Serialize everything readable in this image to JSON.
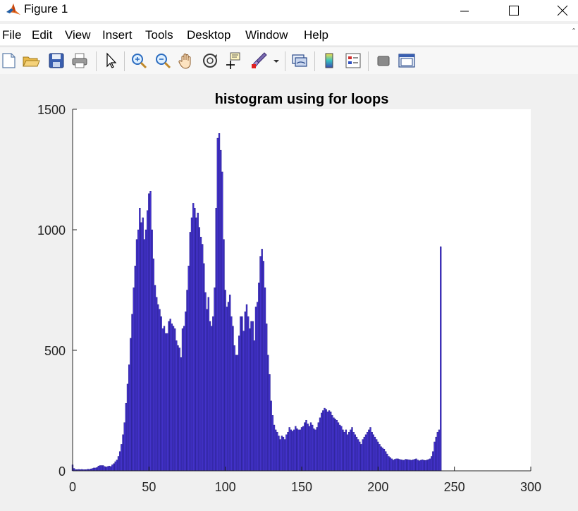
{
  "window": {
    "title": "Figure 1",
    "icon": "matlab-icon"
  },
  "menu": {
    "items": [
      "File",
      "Edit",
      "View",
      "Insert",
      "Tools",
      "Desktop",
      "Window",
      "Help"
    ]
  },
  "toolbar": {
    "icons": [
      "new-figure-icon",
      "open-file-icon",
      "save-icon",
      "print-icon",
      "pointer-icon",
      "zoom-in-icon",
      "zoom-out-icon",
      "pan-icon",
      "rotate-3d-icon",
      "data-cursor-icon",
      "brush-icon",
      "link-plot-icon",
      "colorbar-icon",
      "legend-icon",
      "hide-plot-tools-icon",
      "show-plot-tools-icon"
    ]
  },
  "colors": {
    "bar_fill": "#4433cc",
    "bar_edge": "#1a1280",
    "axes_bg": "#ffffff",
    "figure_bg": "#f0f0f0"
  },
  "chart_data": {
    "type": "bar",
    "title": "histogram using for loops",
    "xlabel": "",
    "ylabel": "",
    "xlim": [
      0,
      300
    ],
    "ylim": [
      0,
      1500
    ],
    "xticks": [
      0,
      50,
      100,
      150,
      200,
      250,
      300
    ],
    "yticks": [
      0,
      500,
      1000,
      1500
    ],
    "grid": false,
    "x": [
      0,
      1,
      2,
      3,
      4,
      5,
      6,
      7,
      8,
      9,
      10,
      11,
      12,
      13,
      14,
      15,
      16,
      17,
      18,
      19,
      20,
      21,
      22,
      23,
      24,
      25,
      26,
      27,
      28,
      29,
      30,
      31,
      32,
      33,
      34,
      35,
      36,
      37,
      38,
      39,
      40,
      41,
      42,
      43,
      44,
      45,
      46,
      47,
      48,
      49,
      50,
      51,
      52,
      53,
      54,
      55,
      56,
      57,
      58,
      59,
      60,
      61,
      62,
      63,
      64,
      65,
      66,
      67,
      68,
      69,
      70,
      71,
      72,
      73,
      74,
      75,
      76,
      77,
      78,
      79,
      80,
      81,
      82,
      83,
      84,
      85,
      86,
      87,
      88,
      89,
      90,
      91,
      92,
      93,
      94,
      95,
      96,
      97,
      98,
      99,
      100,
      101,
      102,
      103,
      104,
      105,
      106,
      107,
      108,
      109,
      110,
      111,
      112,
      113,
      114,
      115,
      116,
      117,
      118,
      119,
      120,
      121,
      122,
      123,
      124,
      125,
      126,
      127,
      128,
      129,
      130,
      131,
      132,
      133,
      134,
      135,
      136,
      137,
      138,
      139,
      140,
      141,
      142,
      143,
      144,
      145,
      146,
      147,
      148,
      149,
      150,
      151,
      152,
      153,
      154,
      155,
      156,
      157,
      158,
      159,
      160,
      161,
      162,
      163,
      164,
      165,
      166,
      167,
      168,
      169,
      170,
      171,
      172,
      173,
      174,
      175,
      176,
      177,
      178,
      179,
      180,
      181,
      182,
      183,
      184,
      185,
      186,
      187,
      188,
      189,
      190,
      191,
      192,
      193,
      194,
      195,
      196,
      197,
      198,
      199,
      200,
      201,
      202,
      203,
      204,
      205,
      206,
      207,
      208,
      209,
      210,
      211,
      212,
      213,
      214,
      215,
      216,
      217,
      218,
      219,
      220,
      221,
      222,
      223,
      224,
      225,
      226,
      227,
      228,
      229,
      230,
      231,
      232,
      233,
      234,
      235,
      236,
      237,
      238,
      239,
      240,
      241,
      242,
      243,
      244,
      245,
      246,
      247,
      248,
      249,
      250,
      251,
      252,
      253,
      254,
      255
    ],
    "values": [
      25,
      10,
      5,
      5,
      6,
      5,
      6,
      5,
      5,
      5,
      7,
      6,
      8,
      10,
      12,
      12,
      14,
      20,
      22,
      22,
      22,
      18,
      16,
      18,
      20,
      18,
      25,
      30,
      38,
      45,
      60,
      80,
      110,
      150,
      200,
      280,
      360,
      440,
      550,
      650,
      760,
      850,
      960,
      1000,
      1090,
      1030,
      1050,
      960,
      1000,
      1080,
      1150,
      1160,
      1000,
      880,
      770,
      720,
      690,
      670,
      640,
      590,
      600,
      570,
      570,
      620,
      630,
      610,
      600,
      590,
      540,
      520,
      510,
      470,
      590,
      600,
      660,
      750,
      850,
      990,
      1050,
      1110,
      1090,
      1050,
      1070,
      1010,
      970,
      940,
      860,
      740,
      670,
      720,
      620,
      600,
      640,
      760,
      1090,
      1380,
      1400,
      1330,
      1240,
      960,
      750,
      680,
      700,
      730,
      640,
      600,
      520,
      480,
      480,
      560,
      640,
      640,
      580,
      660,
      690,
      640,
      590,
      620,
      620,
      540,
      680,
      700,
      780,
      890,
      920,
      870,
      760,
      610,
      480,
      400,
      290,
      230,
      190,
      170,
      160,
      145,
      130,
      145,
      140,
      130,
      150,
      160,
      180,
      170,
      165,
      170,
      185,
      175,
      170,
      170,
      180,
      185,
      200,
      210,
      195,
      185,
      200,
      190,
      175,
      170,
      180,
      200,
      220,
      240,
      250,
      260,
      255,
      245,
      250,
      245,
      230,
      220,
      215,
      210,
      200,
      190,
      185,
      170,
      160,
      170,
      150,
      160,
      170,
      180,
      160,
      150,
      140,
      130,
      120,
      110,
      130,
      140,
      150,
      160,
      170,
      180,
      160,
      150,
      140,
      130,
      120,
      110,
      100,
      95,
      90,
      80,
      70,
      60,
      55,
      50,
      45,
      48,
      50,
      50,
      48,
      46,
      45,
      44,
      48,
      47,
      46,
      45,
      44,
      46,
      48,
      50,
      45,
      42,
      44,
      46,
      44,
      43,
      45,
      47,
      50,
      60,
      80,
      120,
      140,
      160,
      170,
      930
    ]
  }
}
